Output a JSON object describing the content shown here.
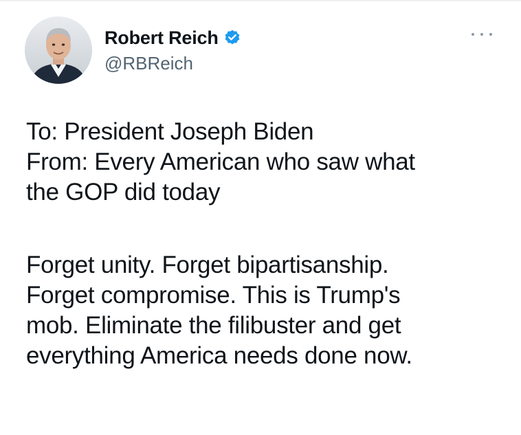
{
  "tweet": {
    "author": {
      "display_name": "Robert Reich",
      "handle": "@RBReich",
      "verified": true,
      "verified_icon": "verified-badge-icon",
      "verified_color": "#1d9bf0"
    },
    "more_icon": "more-horizontal-icon",
    "paragraph1": [
      "To: President Joseph Biden",
      "From: Every American who saw what",
      "the GOP did today"
    ],
    "paragraph2": [
      "Forget unity. Forget bipartisanship.",
      "Forget compromise. This is Trump's",
      "mob. Eliminate the filibuster and get",
      "everything America needs done now."
    ]
  }
}
